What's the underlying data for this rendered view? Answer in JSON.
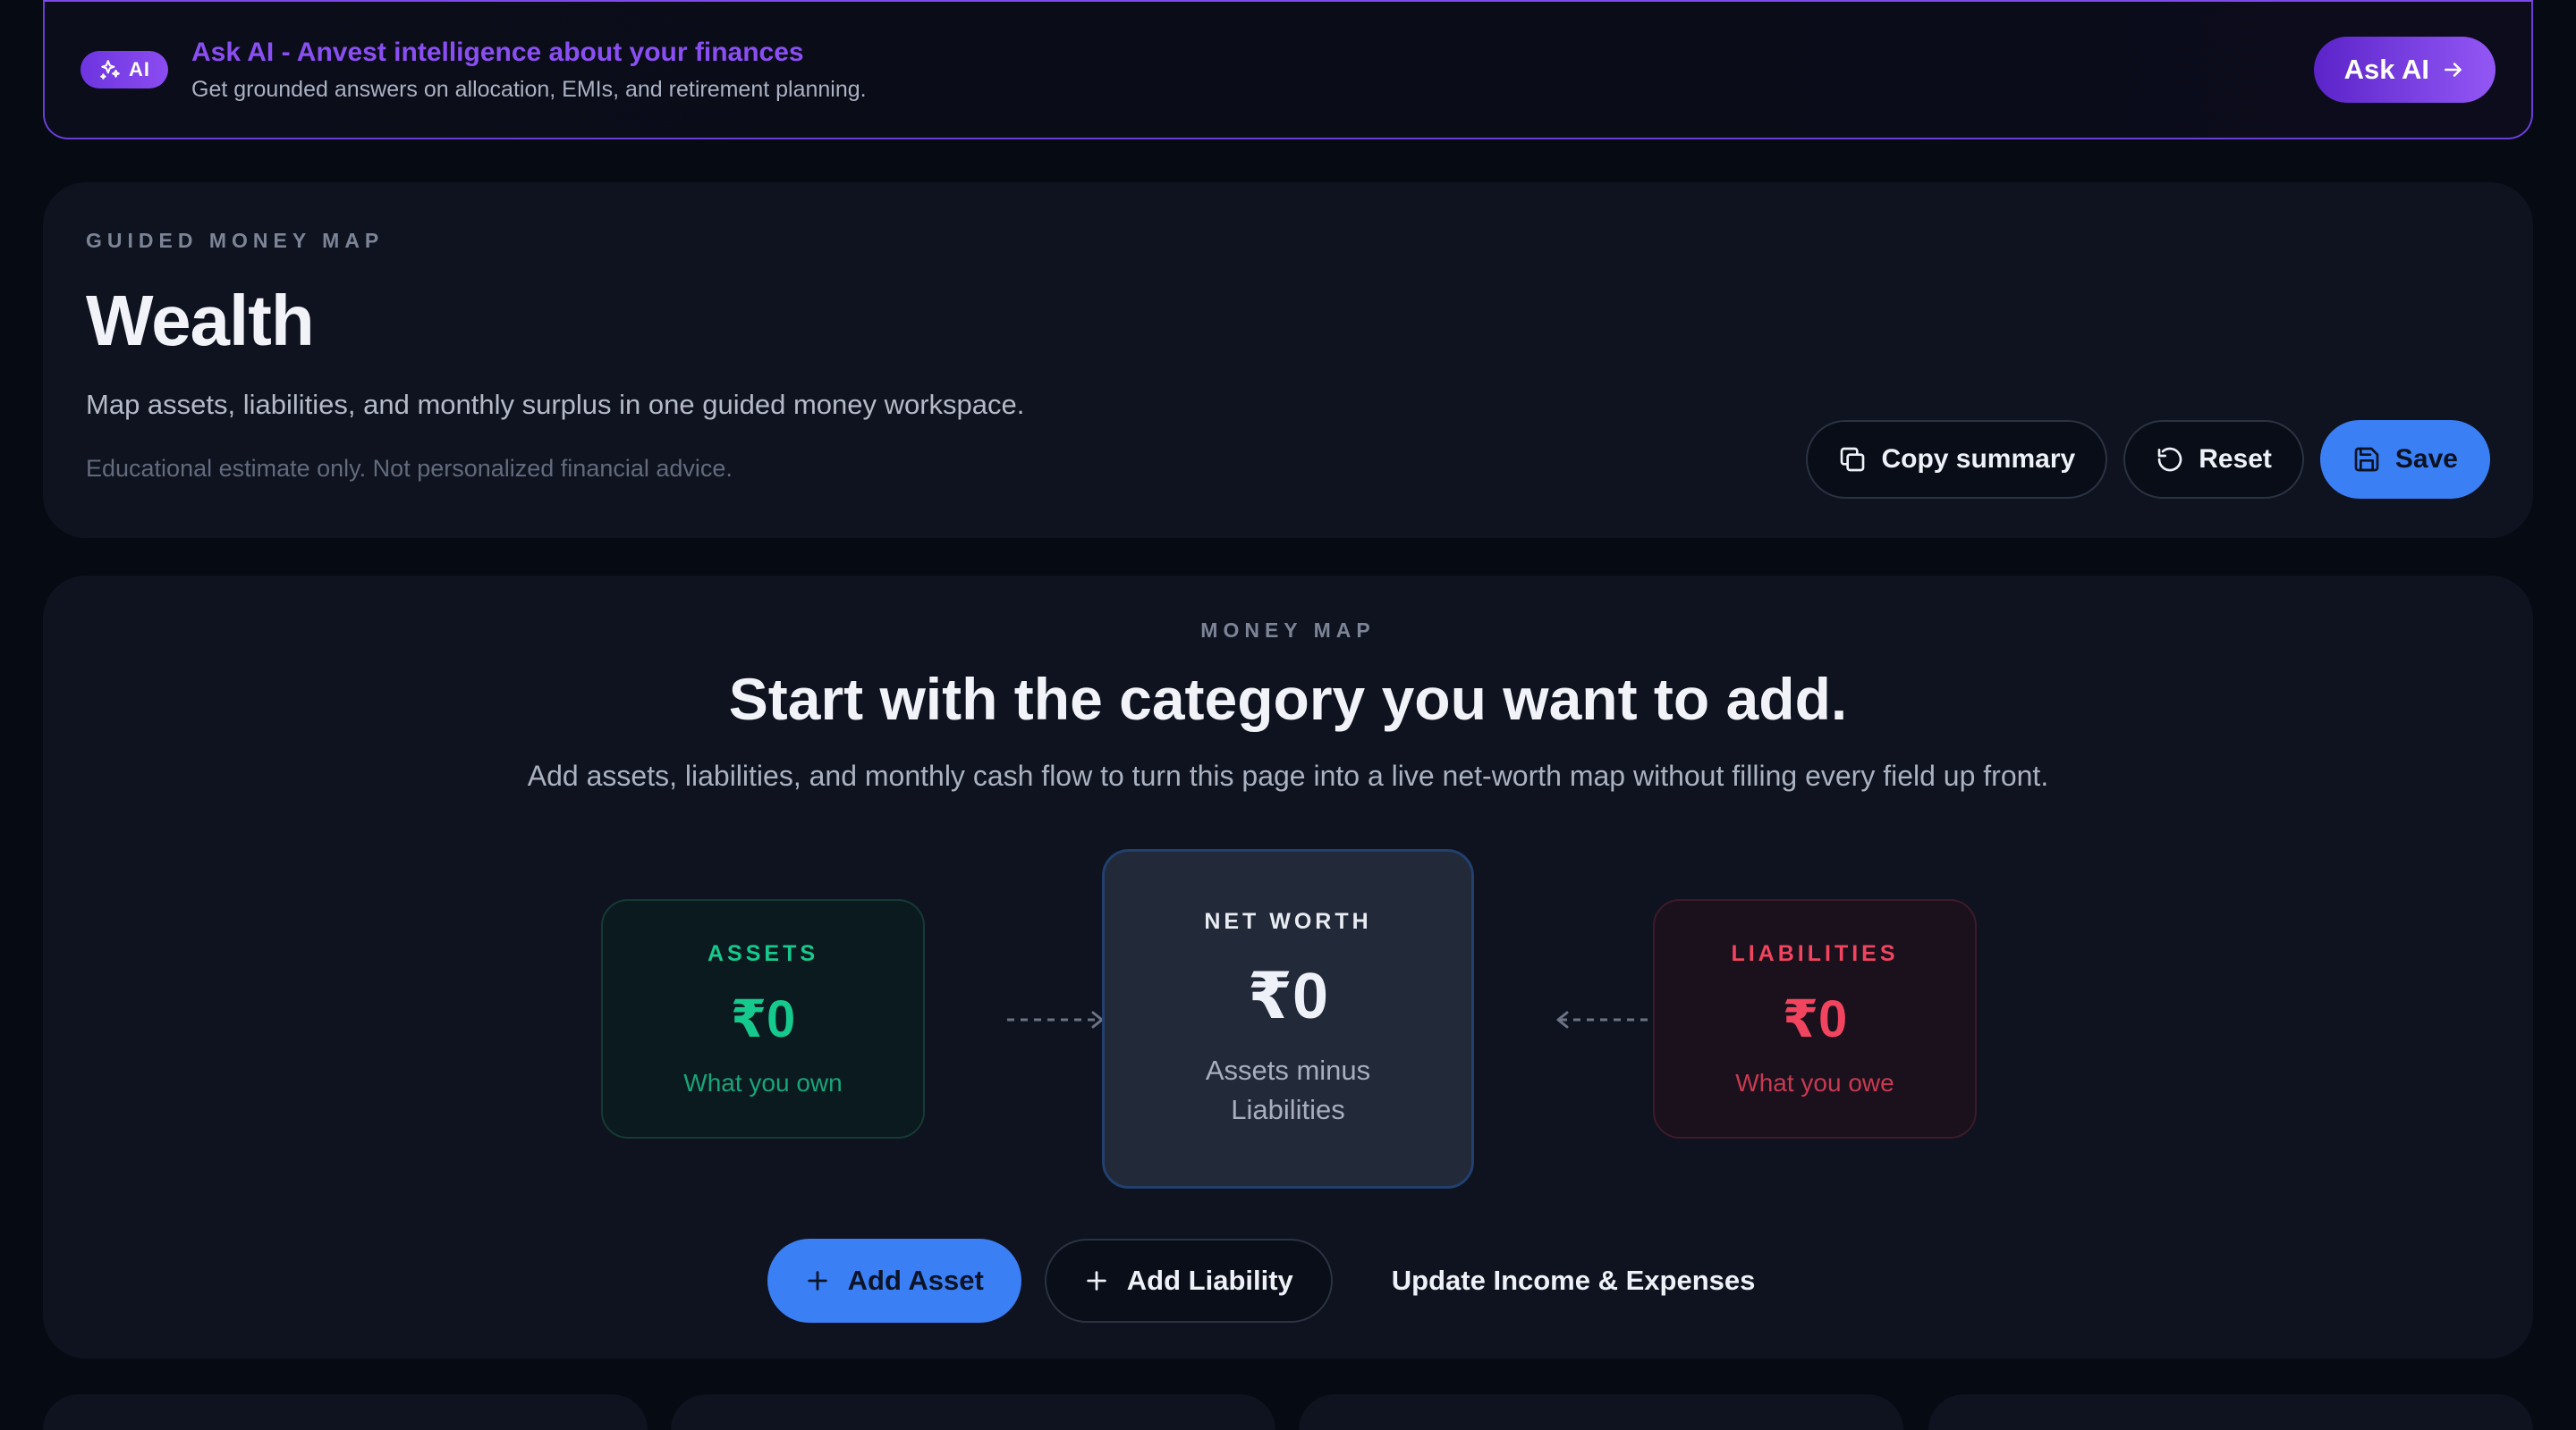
{
  "ai_banner": {
    "badge": "AI",
    "title": "Ask AI - Anvest intelligence about your finances",
    "subtitle": "Get grounded answers on allocation, EMIs, and retirement planning.",
    "button_label": "Ask AI",
    "badge_icon": "sparkles-icon",
    "button_icon": "arrow-right-icon",
    "accent_color": "#7b4ae8"
  },
  "header": {
    "eyebrow": "GUIDED MONEY MAP",
    "title": "Wealth",
    "description": "Map assets, liabilities, and monthly surplus in one guided money workspace.",
    "disclaimer": "Educational estimate only. Not personalized financial advice.",
    "actions": {
      "copy_label": "Copy summary",
      "reset_label": "Reset",
      "save_label": "Save"
    }
  },
  "money_map": {
    "eyebrow": "MONEY MAP",
    "title": "Start with the category you want to add.",
    "description": "Add assets, liabilities, and monthly cash flow to turn this page into a live net-worth map without filling every field up front.",
    "assets": {
      "label": "ASSETS",
      "value": "₹0",
      "sub": "What you own",
      "color": "#16c98d"
    },
    "net_worth": {
      "label": "NET WORTH",
      "value": "₹0",
      "sub": "Assets minus Liabilities"
    },
    "liabilities": {
      "label": "LIABILITIES",
      "value": "₹0",
      "sub": "What you owe",
      "color": "#f0445f"
    },
    "actions": {
      "add_asset": "Add Asset",
      "add_liability": "Add Liability",
      "update_cashflow": "Update Income & Expenses"
    }
  },
  "colors": {
    "background": "#060a13",
    "card": "#0e131f",
    "primary": "#3b7ff4"
  }
}
